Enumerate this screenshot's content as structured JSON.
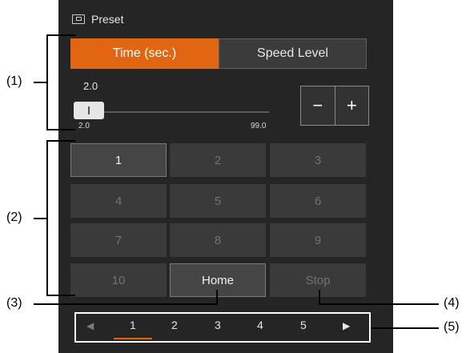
{
  "header": {
    "title": "Preset",
    "icon": "preset-icon"
  },
  "mode_tabs": [
    {
      "label": "Time (sec.)",
      "selected": true
    },
    {
      "label": "Speed Level",
      "selected": false
    }
  ],
  "slider": {
    "value": "2.0",
    "min_label": "2.0",
    "max_label": "99.0",
    "level": 0.0
  },
  "stepper": {
    "minus": "−",
    "plus": "+"
  },
  "preset_buttons": [
    {
      "label": "1",
      "active": true
    },
    {
      "label": "2",
      "active": false
    },
    {
      "label": "3",
      "active": false
    },
    {
      "label": "4",
      "active": false
    },
    {
      "label": "5",
      "active": false
    },
    {
      "label": "6",
      "active": false
    },
    {
      "label": "7",
      "active": false
    },
    {
      "label": "8",
      "active": false
    },
    {
      "label": "9",
      "active": false
    },
    {
      "label": "10",
      "active": false
    },
    {
      "label": "Home",
      "active": true
    },
    {
      "label": "Stop",
      "active": false
    }
  ],
  "pager": {
    "prev": "◀",
    "next": "▶",
    "pages": [
      "1",
      "2",
      "3",
      "4",
      "5"
    ],
    "current": "1"
  },
  "callouts": [
    "(1)",
    "(2)",
    "(3)",
    "(4)",
    "(5)"
  ],
  "colors": {
    "accent": "#e26511",
    "panel": "#252525",
    "button": "#3a3a3a"
  }
}
